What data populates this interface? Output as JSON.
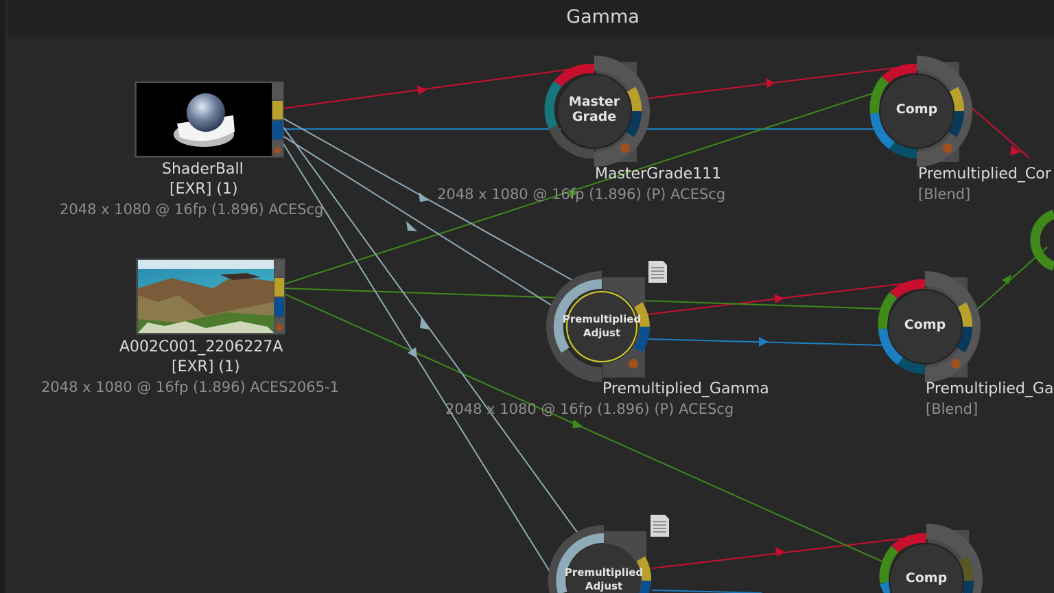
{
  "graph": {
    "title": "Gamma"
  },
  "nodes": {
    "shaderball": {
      "name": "ShaderBall",
      "type": "[EXR] (1)",
      "info": "2048 x 1080 @ 16fp (1.896)  ACEScg"
    },
    "a002": {
      "name": "A002C001_2206227A",
      "type": "[EXR] (1)",
      "info": "2048 x 1080 @ 16fp (1.896)  ACES2065-1"
    },
    "mastergrade": {
      "center_line1": "Master",
      "center_line2": "Grade",
      "name": "MasterGrade111",
      "info": "2048 x 1080 @ 16fp (1.896) (P) ACEScg"
    },
    "premult_gamma": {
      "center_line1": "Premultiplied",
      "center_line2": "Adjust",
      "name": "Premultiplied_Gamma",
      "info": "2048 x 1080 @ 16fp (1.896) (P) ACEScg"
    },
    "premult_adjust_3": {
      "center_line1": "Premultiplied",
      "center_line2": "Adjust"
    },
    "comp_1": {
      "center": "Comp",
      "name": "Premultiplied_Cor",
      "type": "[Blend]"
    },
    "comp_2": {
      "center": "Comp",
      "name": "Premultiplied_Ga",
      "type": "[Blend]"
    },
    "comp_3": {
      "center": "Comp"
    }
  },
  "colors": {
    "background": "#282828",
    "red_link": "#c8102e",
    "blue_link": "#1b7fc4",
    "green_link": "#3f8a1a",
    "gray_link": "#8eabb8",
    "yellow_port": "#b8a02a",
    "orange_dot": "#a0501c",
    "selected_ring": "#d8d020"
  },
  "icons": [
    "document-icon",
    "thumbnail-shaderball",
    "thumbnail-coast"
  ]
}
